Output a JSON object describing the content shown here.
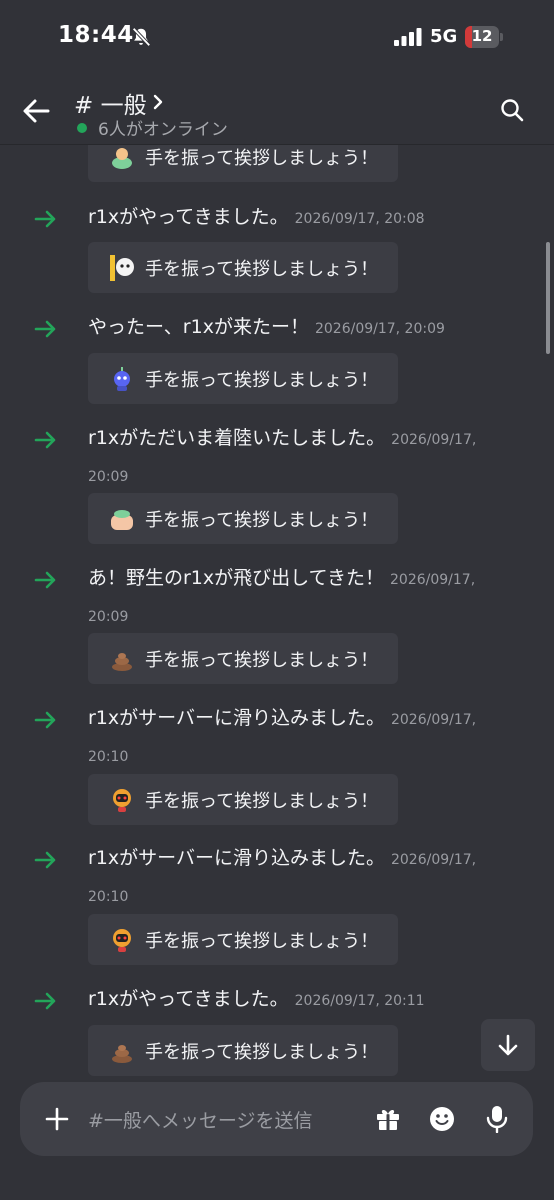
{
  "status": {
    "time": "18:44",
    "network": "5G",
    "battery": "12"
  },
  "header": {
    "channel_title": "# 一般",
    "online_status": "6人がオンライン"
  },
  "wave_label": "手を振って挨拶しましょう！",
  "messages": [
    {
      "text": "r1xがやってきました。",
      "timestamp": "2026/09/17, 20:08"
    },
    {
      "text": "やったー、r1xが来たー！",
      "timestamp": "2026/09/17, 20:09"
    },
    {
      "text": "r1xがただいま着陸いたしました。",
      "timestamp": "2026/09/17, 20:09"
    },
    {
      "text": "あ！野生のr1xが飛び出してきた！",
      "timestamp": "2026/09/17, 20:09"
    },
    {
      "text": "r1xがサーバーに滑り込みました。",
      "timestamp": "2026/09/17, 20:10"
    },
    {
      "text": "r1xがサーバーに滑り込みました。",
      "timestamp": "2026/09/17, 20:10"
    },
    {
      "text": "r1xがやってきました。",
      "timestamp": "2026/09/17, 20:11"
    }
  ],
  "composer": {
    "placeholder": "#一般へメッセージを送信"
  },
  "colors": {
    "background": "#323339",
    "join_arrow": "#23a55a",
    "online": "#23a55a",
    "battery_low": "#d23a3a"
  }
}
